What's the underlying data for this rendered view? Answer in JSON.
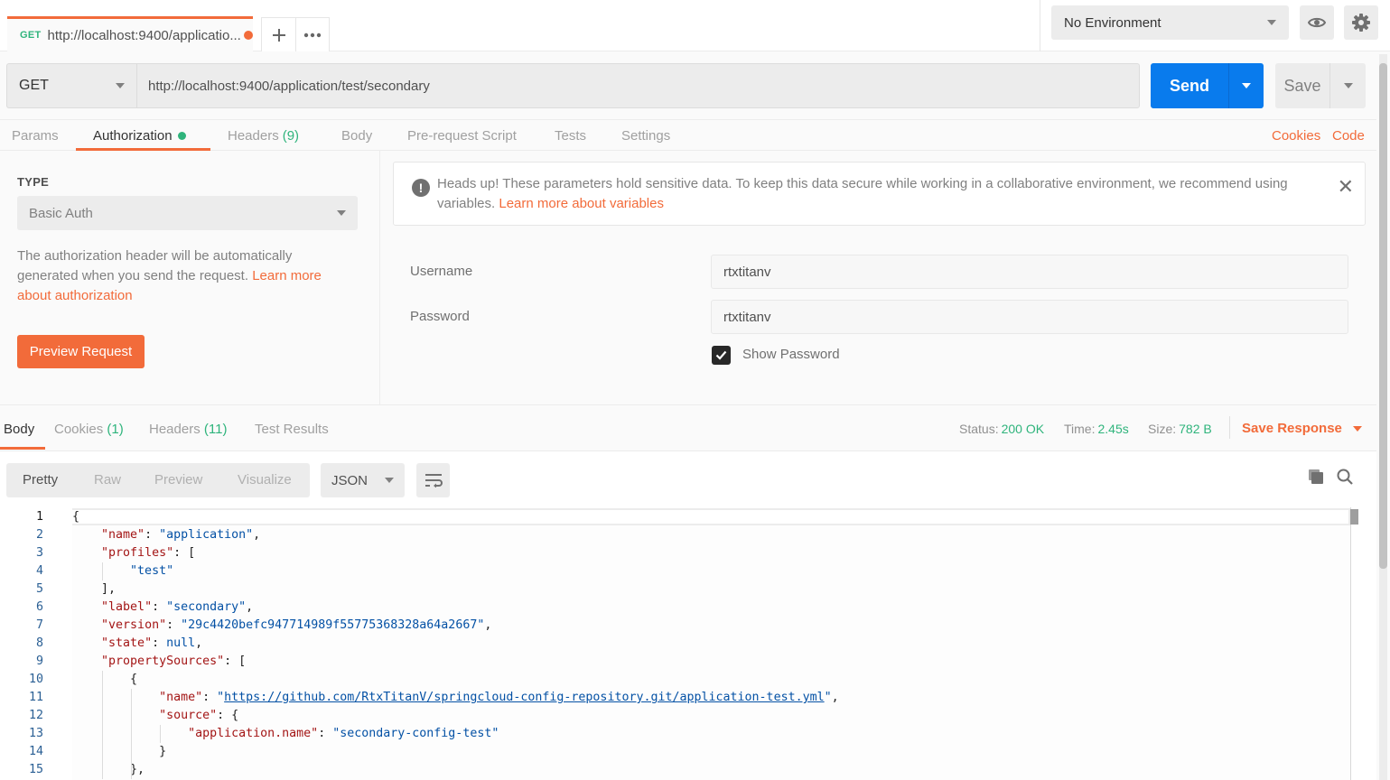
{
  "top_tab": {
    "method": "GET",
    "title": "http://localhost:9400/applicatio...",
    "unsaved_indicator": true
  },
  "tab_actions": {
    "new_tab_icon": "plus-icon",
    "more_icon": "ellipsis-icon"
  },
  "environment": {
    "selected": "No Environment",
    "quick_look_icon": "eye-icon",
    "settings_icon": "gear-icon"
  },
  "request": {
    "method": "GET",
    "url": "http://localhost:9400/application/test/secondary",
    "send_label": "Send",
    "save_label": "Save"
  },
  "request_tabs": [
    {
      "label": "Params",
      "active": false
    },
    {
      "label": "Authorization",
      "active": true,
      "indicator": "green-dot"
    },
    {
      "label": "Headers",
      "count": "(9)",
      "active": false
    },
    {
      "label": "Body",
      "active": false
    },
    {
      "label": "Pre-request Script",
      "active": false
    },
    {
      "label": "Tests",
      "active": false
    },
    {
      "label": "Settings",
      "active": false
    }
  ],
  "request_links": {
    "cookies": "Cookies",
    "code": "Code"
  },
  "auth": {
    "type_label": "TYPE",
    "type_value": "Basic Auth",
    "description": "The authorization header will be automatically generated when you send the request. ",
    "description_link": "Learn more about authorization",
    "preview_button": "Preview Request",
    "warning_text": "Heads up! These parameters hold sensitive data. To keep this data secure while working in a collaborative environment, we recommend using variables. ",
    "warning_link": "Learn more about variables",
    "username_label": "Username",
    "username_value": "rtxtitanv",
    "password_label": "Password",
    "password_value": "rtxtitanv",
    "show_password_label": "Show Password",
    "show_password_checked": true
  },
  "response_tabs": [
    {
      "label": "Body",
      "active": true
    },
    {
      "label": "Cookies",
      "count": "(1)",
      "active": false
    },
    {
      "label": "Headers",
      "count": "(11)",
      "active": false
    },
    {
      "label": "Test Results",
      "active": false
    }
  ],
  "response_meta": {
    "status_label": "Status:",
    "status_value": "200 OK",
    "time_label": "Time:",
    "time_value": "2.45s",
    "size_label": "Size:",
    "size_value": "782 B",
    "save_response": "Save Response"
  },
  "view_modes": [
    "Pretty",
    "Raw",
    "Preview",
    "Visualize"
  ],
  "active_view_mode": "Pretty",
  "format": "JSON",
  "colors": {
    "accent_orange": "#f26b3a",
    "send_blue": "#097bed",
    "success_green": "#2fb47c"
  },
  "response_body": {
    "line_numbers": [
      "1",
      "2",
      "3",
      "4",
      "5",
      "6",
      "7",
      "8",
      "9",
      "10",
      "11",
      "12",
      "13",
      "14",
      "15"
    ],
    "lines": [
      [
        {
          "t": "p",
          "v": "{"
        }
      ],
      [
        {
          "t": "p",
          "v": "    "
        },
        {
          "t": "k",
          "v": "\"name\""
        },
        {
          "t": "p",
          "v": ": "
        },
        {
          "t": "s",
          "v": "\"application\""
        },
        {
          "t": "p",
          "v": ","
        }
      ],
      [
        {
          "t": "p",
          "v": "    "
        },
        {
          "t": "k",
          "v": "\"profiles\""
        },
        {
          "t": "p",
          "v": ": ["
        }
      ],
      [
        {
          "t": "p",
          "v": "        "
        },
        {
          "t": "s",
          "v": "\"test\""
        }
      ],
      [
        {
          "t": "p",
          "v": "    ],"
        }
      ],
      [
        {
          "t": "p",
          "v": "    "
        },
        {
          "t": "k",
          "v": "\"label\""
        },
        {
          "t": "p",
          "v": ": "
        },
        {
          "t": "s",
          "v": "\"secondary\""
        },
        {
          "t": "p",
          "v": ","
        }
      ],
      [
        {
          "t": "p",
          "v": "    "
        },
        {
          "t": "k",
          "v": "\"version\""
        },
        {
          "t": "p",
          "v": ": "
        },
        {
          "t": "s",
          "v": "\"29c4420befc947714989f55775368328a64a2667\""
        },
        {
          "t": "p",
          "v": ","
        }
      ],
      [
        {
          "t": "p",
          "v": "    "
        },
        {
          "t": "k",
          "v": "\"state\""
        },
        {
          "t": "p",
          "v": ": "
        },
        {
          "t": "n",
          "v": "null"
        },
        {
          "t": "p",
          "v": ","
        }
      ],
      [
        {
          "t": "p",
          "v": "    "
        },
        {
          "t": "k",
          "v": "\"propertySources\""
        },
        {
          "t": "p",
          "v": ": ["
        }
      ],
      [
        {
          "t": "p",
          "v": "        {"
        }
      ],
      [
        {
          "t": "p",
          "v": "            "
        },
        {
          "t": "k",
          "v": "\"name\""
        },
        {
          "t": "p",
          "v": ": "
        },
        {
          "t": "s",
          "v": "\""
        },
        {
          "t": "u",
          "v": "https://github.com/RtxTitanV/springcloud-config-repository.git/application-test.yml"
        },
        {
          "t": "s",
          "v": "\""
        },
        {
          "t": "p",
          "v": ","
        }
      ],
      [
        {
          "t": "p",
          "v": "            "
        },
        {
          "t": "k",
          "v": "\"source\""
        },
        {
          "t": "p",
          "v": ": {"
        }
      ],
      [
        {
          "t": "p",
          "v": "                "
        },
        {
          "t": "k",
          "v": "\"application.name\""
        },
        {
          "t": "p",
          "v": ": "
        },
        {
          "t": "s",
          "v": "\"secondary-config-test\""
        }
      ],
      [
        {
          "t": "p",
          "v": "            }"
        }
      ],
      [
        {
          "t": "p",
          "v": "        },"
        }
      ]
    ]
  }
}
